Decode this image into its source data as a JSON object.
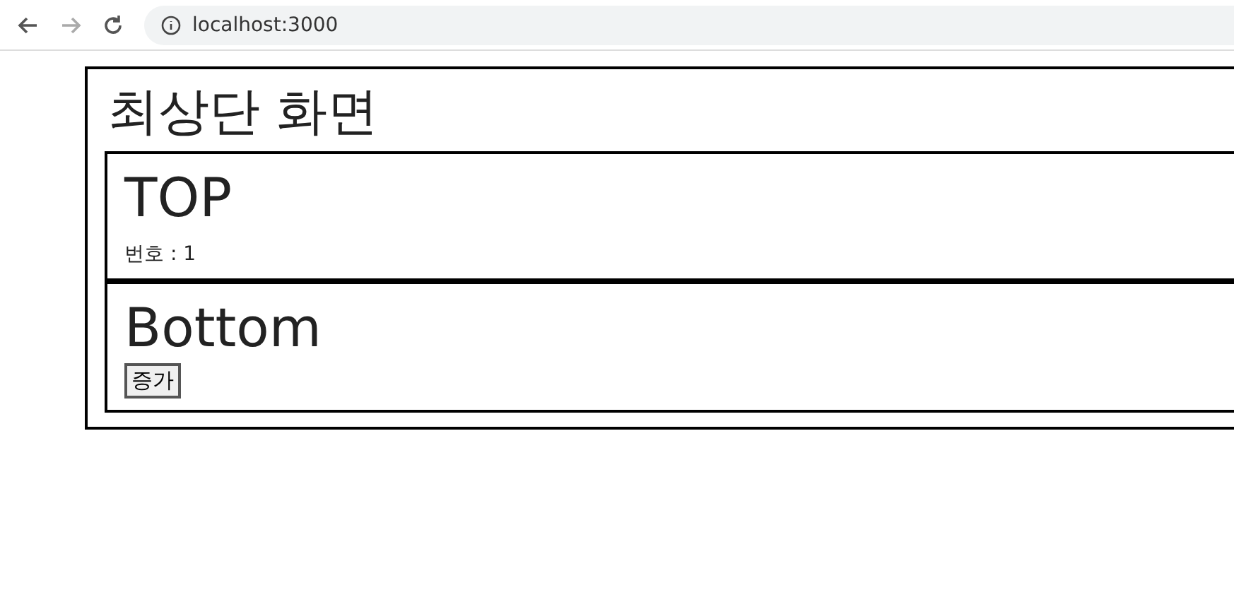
{
  "browser": {
    "address": "localhost:3000"
  },
  "page": {
    "title": "최상단 화면",
    "panels": [
      {
        "kind": "counter",
        "heading": "TOP",
        "text": "번호 : 1"
      },
      {
        "kind": "control",
        "heading": "Bottom",
        "button": "증가"
      }
    ]
  }
}
